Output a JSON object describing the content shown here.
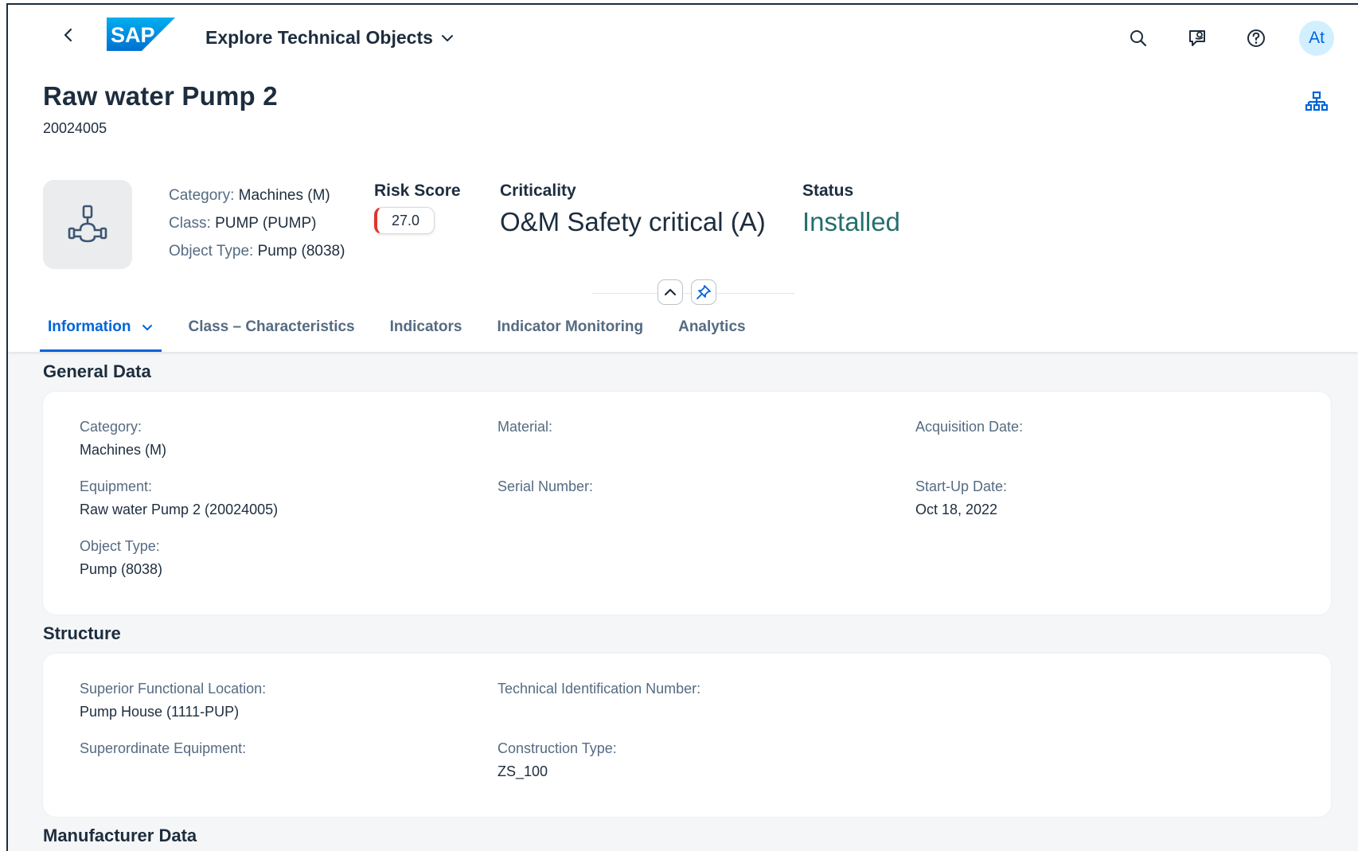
{
  "shell": {
    "app_title": "Explore Technical Objects",
    "logo_text": "SAP",
    "avatar_initials": "At"
  },
  "object": {
    "title": "Raw water Pump 2",
    "id": "20024005"
  },
  "header_attributes": [
    {
      "label": "Category:",
      "value": "Machines (M)"
    },
    {
      "label": "Class:",
      "value": "PUMP (PUMP)"
    },
    {
      "label": "Object Type:",
      "value": "Pump (8038)"
    }
  ],
  "kpis": {
    "risk_score": {
      "title": "Risk Score",
      "value": "27.0",
      "indicator_color": "#e0342b"
    },
    "criticality": {
      "title": "Criticality",
      "value": "O&M Safety critical (A)"
    },
    "status": {
      "title": "Status",
      "value": "Installed",
      "color": "#256f6e"
    }
  },
  "tabs": [
    {
      "label": "Information",
      "active": true,
      "has_dropdown": true
    },
    {
      "label": "Class – Characteristics",
      "active": false
    },
    {
      "label": "Indicators",
      "active": false
    },
    {
      "label": "Indicator Monitoring",
      "active": false
    },
    {
      "label": "Analytics",
      "active": false
    }
  ],
  "sections": {
    "general_data": {
      "title": "General Data",
      "fields": {
        "category": {
          "label": "Category:",
          "value": "Machines (M)"
        },
        "equipment": {
          "label": "Equipment:",
          "value": "Raw water Pump 2 (20024005)"
        },
        "object_type": {
          "label": "Object Type:",
          "value": "Pump (8038)"
        },
        "material": {
          "label": "Material:",
          "value": ""
        },
        "serial_number": {
          "label": "Serial Number:",
          "value": ""
        },
        "acquisition_date": {
          "label": "Acquisition Date:",
          "value": ""
        },
        "startup_date": {
          "label": "Start-Up Date:",
          "value": "Oct 18, 2022"
        }
      }
    },
    "structure": {
      "title": "Structure",
      "fields": {
        "superior_fl": {
          "label": "Superior Functional Location:",
          "value": "Pump House (1111-PUP)"
        },
        "superordinate_eq": {
          "label": "Superordinate Equipment:",
          "value": ""
        },
        "tech_id": {
          "label": "Technical Identification Number:",
          "value": ""
        },
        "construction_type": {
          "label": "Construction Type:",
          "value": "ZS_100"
        }
      }
    },
    "manufacturer_data": {
      "title": "Manufacturer Data"
    }
  },
  "colors": {
    "accent": "#0064d9",
    "text": "#1d2d3e",
    "label": "#556b82",
    "page_bg": "#f5f6f7"
  }
}
